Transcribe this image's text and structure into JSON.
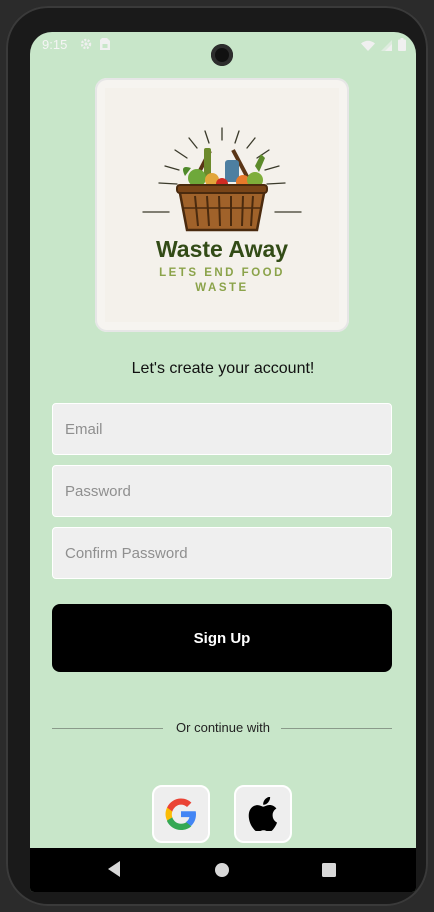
{
  "status_bar": {
    "time": "9:15",
    "left_icons": [
      "gear-icon",
      "sim-card-icon"
    ],
    "right_icons": [
      "wifi-icon",
      "signal-icon",
      "battery-icon"
    ]
  },
  "logo": {
    "title": "Waste Away",
    "tagline": "LETS END FOOD WASTE",
    "title_color": "#324b16",
    "tagline_color": "#8ba34a"
  },
  "heading": "Let's create your account!",
  "form": {
    "email": {
      "value": "",
      "placeholder": "Email"
    },
    "password": {
      "value": "",
      "placeholder": "Password"
    },
    "confirm_password": {
      "value": "",
      "placeholder": "Confirm Password"
    }
  },
  "signup_label": "Sign Up",
  "divider_text": "Or continue with",
  "social": [
    "google-icon",
    "apple-icon"
  ],
  "nav": [
    "back-icon",
    "home-icon",
    "recents-icon"
  ],
  "colors": {
    "background": "#c8e6c9",
    "button": "#000000"
  }
}
